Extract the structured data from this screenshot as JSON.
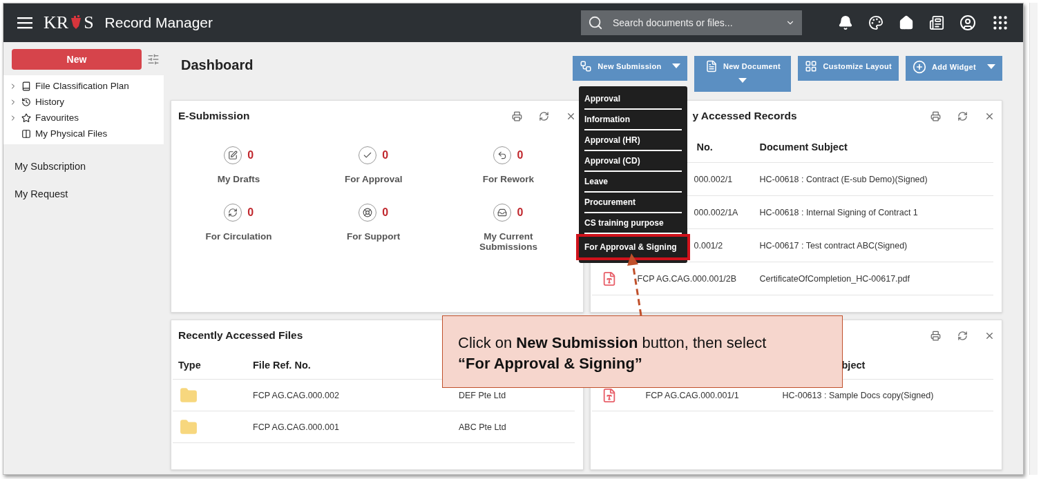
{
  "header": {
    "logo_left": "KR",
    "logo_right": "S",
    "app_title": "Record Manager",
    "search": {
      "placeholder": "Search documents or files..."
    }
  },
  "sidebar": {
    "new_button": "New",
    "tree": [
      {
        "label": "File Classification Plan",
        "expanded": false
      },
      {
        "label": "History",
        "expanded": false
      },
      {
        "label": "Favourites",
        "expanded": false
      },
      {
        "label": "My Physical Files"
      }
    ],
    "links": [
      "My Subscription",
      "My Request"
    ]
  },
  "page_title": "Dashboard",
  "toolbar": [
    {
      "label": "New Submission",
      "kind": "dropdown"
    },
    {
      "label": "New Document",
      "kind": "stacked"
    },
    {
      "label": "Customize Layout",
      "kind": "plain"
    },
    {
      "label": "Add Widget",
      "kind": "dropdown"
    }
  ],
  "submission_menu": [
    {
      "label": "Approval",
      "highlighted": false
    },
    {
      "label": "Information",
      "highlighted": false
    },
    {
      "label": "Approval (HR)",
      "highlighted": false
    },
    {
      "label": "Approval (CD)",
      "highlighted": false
    },
    {
      "label": "Leave",
      "highlighted": false
    },
    {
      "label": "Procurement",
      "highlighted": false
    },
    {
      "label": "CS training purpose",
      "highlighted": false
    },
    {
      "label": "For Approval & Signing",
      "highlighted": true
    }
  ],
  "esubmission": {
    "title": "E-Submission",
    "counters": [
      {
        "count": "0",
        "label": "My Drafts"
      },
      {
        "count": "0",
        "label": "For Approval"
      },
      {
        "count": "0",
        "label": "For Rework"
      },
      {
        "count": "0",
        "label": "For Circulation"
      },
      {
        "count": "0",
        "label": "For Support"
      },
      {
        "count": "0",
        "label": "My Current Submissions"
      }
    ]
  },
  "records": {
    "title": "y Accessed Records",
    "columns": [
      {
        "label": "No.",
        "kind": "partly_hidden"
      },
      {
        "label": "Document Subject",
        "kind": "full"
      }
    ],
    "rows": [
      {
        "kind": "partly_hidden",
        "doc_no": "000.002/1",
        "subject": "HC-00618 : Contract (E-sub Demo)(Signed)"
      },
      {
        "kind": "partly_hidden",
        "doc_no": "000.002/1A",
        "subject": "HC-00618 : Internal Signing of Contract 1"
      },
      {
        "kind": "partly_hidden",
        "doc_no": "0.001/2",
        "subject": "HC-00617 : Test contract ABC(Signed)"
      },
      {
        "kind": "full",
        "doc_no": "FCP AG.CAG.000.001/2B",
        "subject": "CertificateOfCompletion_HC-00617.pdf"
      }
    ]
  },
  "files": {
    "title": "Recently Accessed Files",
    "columns": [
      "Type",
      "File Ref. No."
    ],
    "rows": [
      {
        "ref": "FCP AG.CAG.000.002",
        "owner": "DEF Pte Ltd"
      },
      {
        "ref": "FCP AG.CAG.000.001",
        "owner": "ABC Pte Ltd"
      }
    ]
  },
  "records_lower": {
    "columns": [
      {
        "label": "bject",
        "kind": "partly_hidden"
      }
    ],
    "rows": [
      {
        "kind": "full",
        "doc_no": "FCP AG.CAG.000.001/1",
        "subject": "HC-00613 : Sample Docs copy(Signed)"
      }
    ]
  },
  "callout": {
    "text": "Click on **New Submission** button, then select **“For Approval & Signing”**"
  }
}
